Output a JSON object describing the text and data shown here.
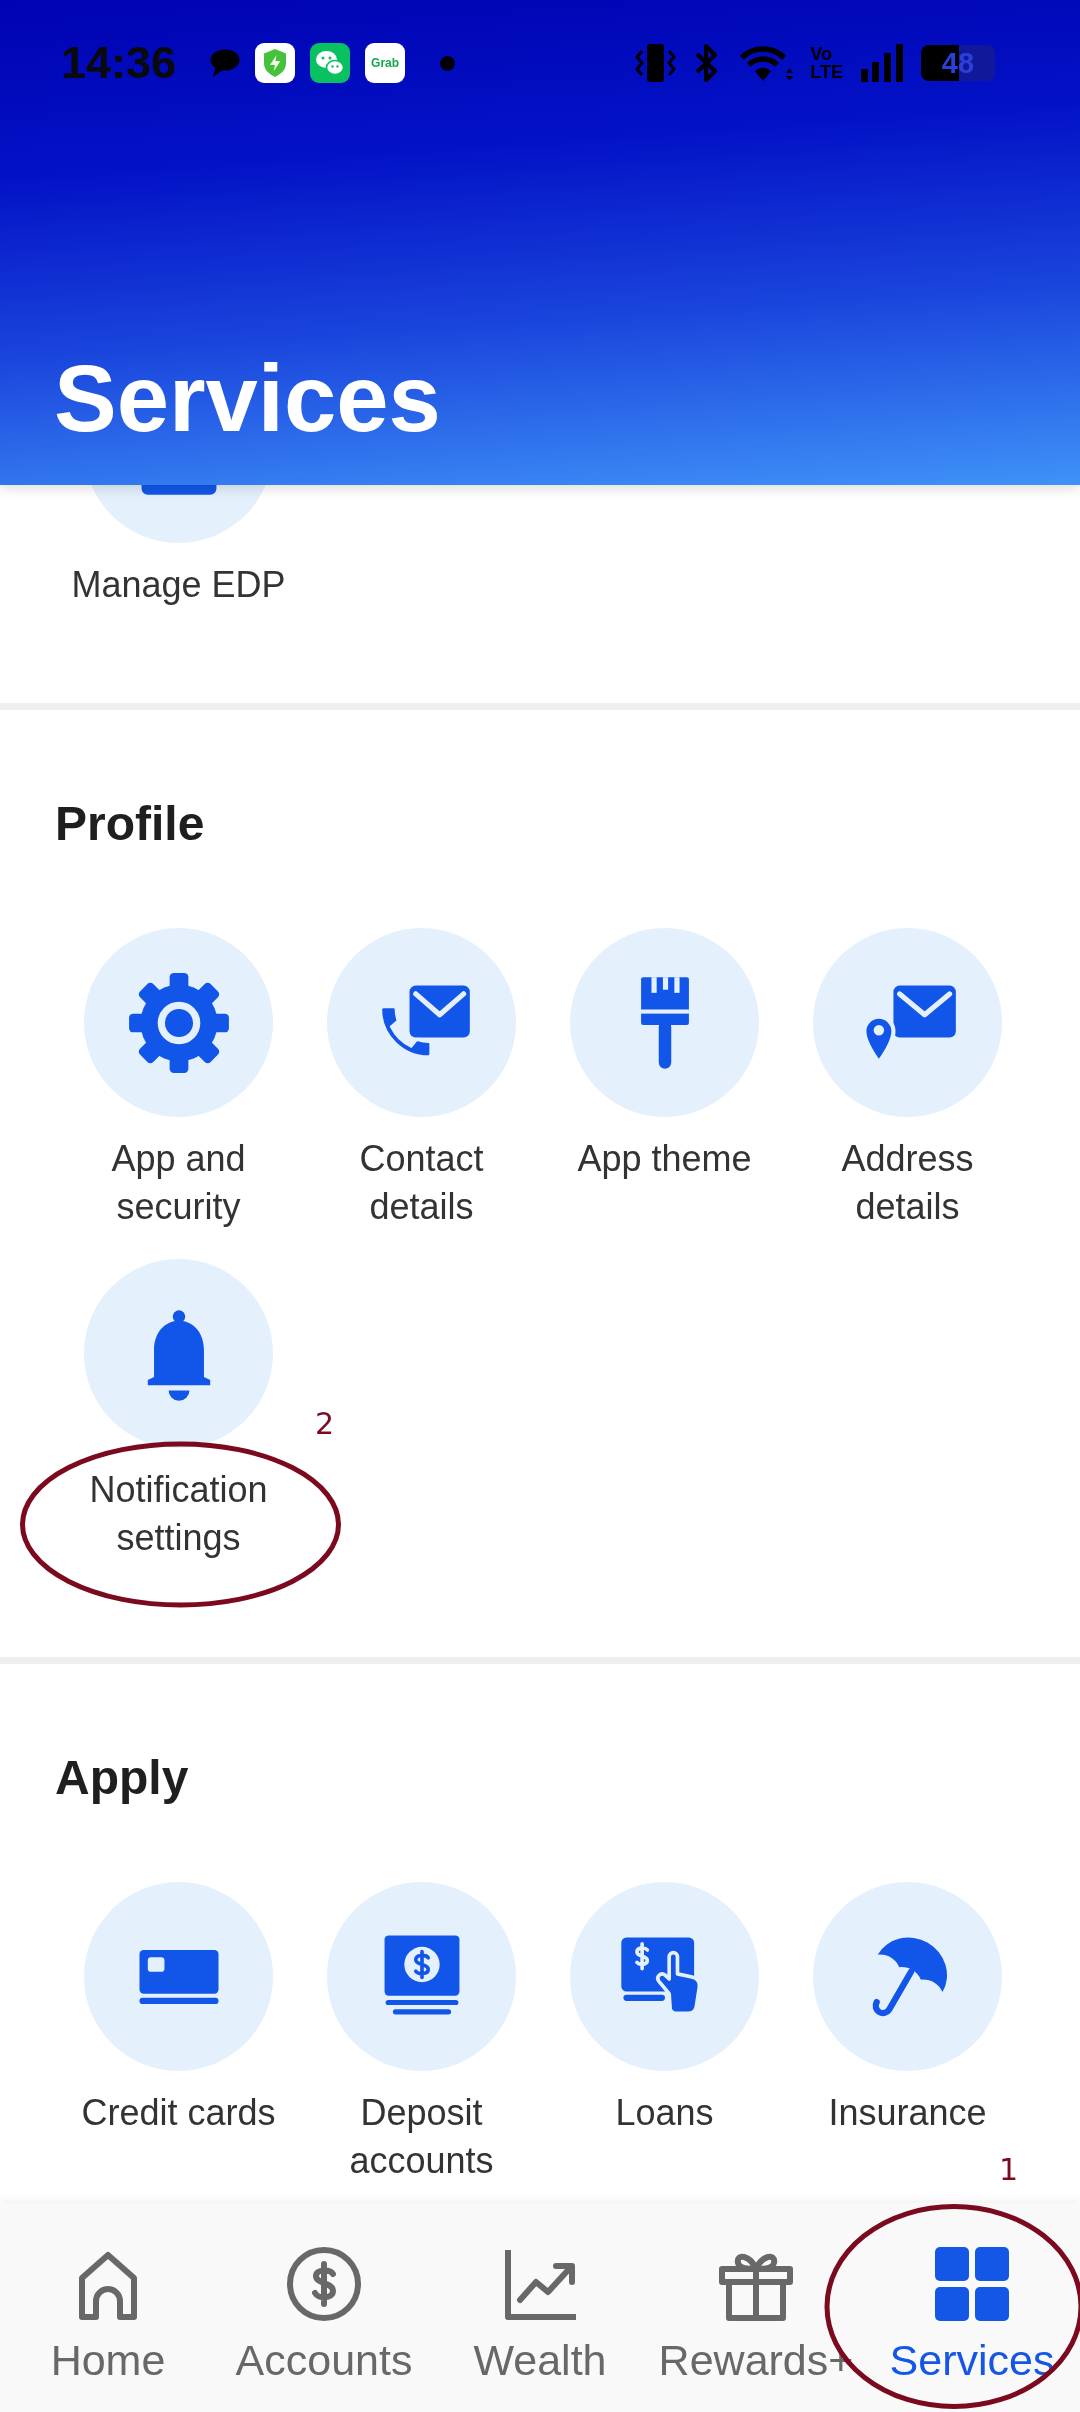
{
  "status_bar": {
    "time": "14:36",
    "notifications": [
      {
        "kind": "message"
      },
      {
        "kind": "security_app"
      },
      {
        "kind": "chat_app"
      },
      {
        "kind": "text_app",
        "label": "Grab"
      },
      {
        "kind": "dot"
      }
    ],
    "network": [
      "Vo",
      "LTE"
    ],
    "battery": "48"
  },
  "header": {
    "title": "Services"
  },
  "sections": [
    {
      "items": [
        {
          "label": "Manage EDP"
        }
      ]
    },
    {
      "title": "Profile",
      "items": [
        {
          "label": "App and security"
        },
        {
          "label": "Contact details"
        },
        {
          "label": "App theme"
        },
        {
          "label": "Address details"
        },
        {
          "label": "Notification settings",
          "annotation": "2"
        }
      ]
    },
    {
      "title": "Apply",
      "items": [
        {
          "label": "Credit cards"
        },
        {
          "label": "Deposit accounts"
        },
        {
          "label": "Loans"
        },
        {
          "label": "Insurance"
        }
      ]
    }
  ],
  "bottom_nav": [
    {
      "label": "Home",
      "selected": false
    },
    {
      "label": "Accounts",
      "selected": false
    },
    {
      "label": "Wealth",
      "selected": false
    },
    {
      "label": "Rewards+",
      "selected": false
    },
    {
      "label": "Services",
      "selected": true,
      "annotation": "1"
    }
  ]
}
